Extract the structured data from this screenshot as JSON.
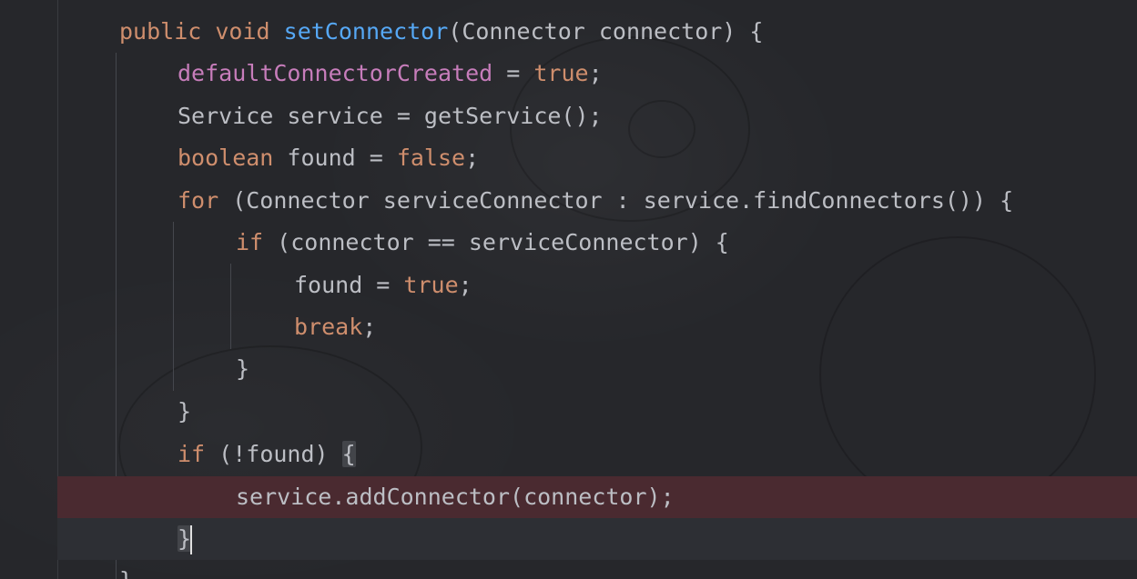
{
  "editor": {
    "lines": [
      {
        "id": "l1",
        "tokens": [
          [
            "kw",
            "public"
          ],
          [
            "plain",
            " "
          ],
          [
            "kw",
            "void"
          ],
          [
            "plain",
            " "
          ],
          [
            "fn",
            "setConnector"
          ],
          [
            "plain",
            "(Connector connector) {"
          ]
        ]
      },
      {
        "id": "l2",
        "tokens": [
          [
            "field",
            "defaultConnectorCreated"
          ],
          [
            "plain",
            " = "
          ],
          [
            "kw",
            "true"
          ],
          [
            "plain",
            ";"
          ]
        ]
      },
      {
        "id": "l3",
        "tokens": [
          [
            "plain",
            "Service service = getService();"
          ]
        ]
      },
      {
        "id": "l4",
        "tokens": [
          [
            "kw",
            "boolean"
          ],
          [
            "plain",
            " found = "
          ],
          [
            "kw",
            "false"
          ],
          [
            "plain",
            ";"
          ]
        ]
      },
      {
        "id": "l5",
        "tokens": [
          [
            "kw",
            "for"
          ],
          [
            "plain",
            " (Connector serviceConnector : service.findConnectors()) {"
          ]
        ]
      },
      {
        "id": "l6",
        "tokens": [
          [
            "kw",
            "if"
          ],
          [
            "plain",
            " (connector == serviceConnector) {"
          ]
        ]
      },
      {
        "id": "l7",
        "tokens": [
          [
            "plain",
            "found = "
          ],
          [
            "kw",
            "true"
          ],
          [
            "plain",
            ";"
          ]
        ]
      },
      {
        "id": "l8",
        "tokens": [
          [
            "kw",
            "break"
          ],
          [
            "plain",
            ";"
          ]
        ]
      },
      {
        "id": "l9",
        "tokens": [
          [
            "plain",
            "}"
          ]
        ]
      },
      {
        "id": "l10",
        "tokens": [
          [
            "plain",
            "}"
          ]
        ]
      },
      {
        "id": "l11",
        "tokens": [
          [
            "kw",
            "if"
          ],
          [
            "plain",
            " (!found) "
          ],
          [
            "match",
            "{"
          ]
        ]
      },
      {
        "id": "l12",
        "tokens": [
          [
            "plain",
            "service.addConnector(connector);"
          ]
        ]
      },
      {
        "id": "l13",
        "tokens": [
          [
            "match",
            "}"
          ],
          [
            "caret",
            ""
          ]
        ]
      },
      {
        "id": "l14",
        "tokens": [
          [
            "plain",
            "}"
          ]
        ]
      }
    ],
    "colors": {
      "keyword": "#cf8e6d",
      "method": "#56a8f5",
      "field": "#c77dbb",
      "text": "#bcbec4",
      "breakpoint_line": "#4a2a30",
      "background": "#26272b"
    }
  }
}
